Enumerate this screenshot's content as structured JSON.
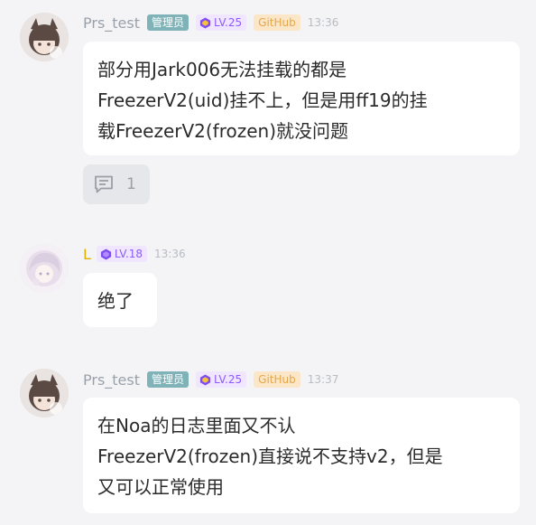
{
  "messages": [
    {
      "user": "Prs_test",
      "role_badge": "管理员",
      "level": "LV.25",
      "source_badge": "GitHub",
      "time": "13:36",
      "lines": [
        "部分用Jark006无法挂载的都是",
        "FreezerV2(uid)挂不上，但是用ff19的挂",
        "载FreezerV2(frozen)就没问题"
      ],
      "reply_count": "1"
    },
    {
      "user": "L",
      "level": "LV.18",
      "time": "13:36",
      "lines": [
        "绝了"
      ]
    },
    {
      "user": "Prs_test",
      "role_badge": "管理员",
      "level": "LV.25",
      "source_badge": "GitHub",
      "time": "13:37",
      "lines": [
        "在Noa的日志里面又不认",
        "FreezerV2(frozen)直接说不支持v2，但是",
        "又可以正常使用"
      ]
    }
  ],
  "icons": {
    "level": "hexagon-level-icon",
    "reply": "comment-icon"
  },
  "colors": {
    "background": "#f4f4f6",
    "bubble": "#ffffff",
    "admin_badge": "#7fb3b8",
    "github_badge_bg": "#fbe7c8",
    "github_badge_text": "#e6a74a",
    "level_badge_bg": "#f1e6ff",
    "level_badge_text": "#8b5cf6",
    "gold_name": "#e0b000"
  }
}
